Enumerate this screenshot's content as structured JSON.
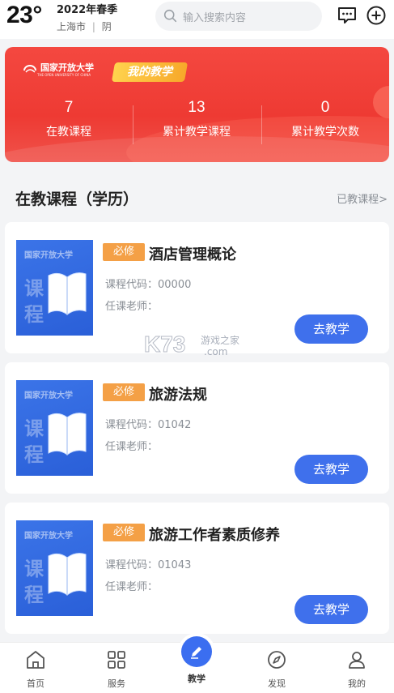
{
  "header": {
    "temperature": "23°",
    "term": "2022年春季",
    "location": "上海市",
    "weather": "阴",
    "search_placeholder": "输入搜索内容"
  },
  "banner": {
    "university": "国家开放大学",
    "university_en": "THE OPEN UNIVERSITY OF CHINA",
    "tag": "我的教学",
    "stats": [
      {
        "value": "7",
        "label": "在教课程"
      },
      {
        "value": "13",
        "label": "累计教学课程"
      },
      {
        "value": "0",
        "label": "累计教学次数"
      }
    ]
  },
  "section": {
    "title": "在教课程（学历）",
    "more": "已教课程>"
  },
  "courses": [
    {
      "badge": "必修",
      "name": "酒店管理概论",
      "code_label": "课程代码：00000",
      "teacher_label": "任课老师：",
      "button": "去教学"
    },
    {
      "badge": "必修",
      "name": "旅游法规",
      "code_label": "课程代码：01042",
      "teacher_label": "任课老师：",
      "button": "去教学"
    },
    {
      "badge": "必修",
      "name": "旅游工作者素质修养",
      "code_label": "课程代码：01043",
      "teacher_label": "任课老师：",
      "button": "去教学"
    }
  ],
  "cover": {
    "top": "国家开放大学",
    "char1": "课",
    "char2": "程"
  },
  "watermark": {
    "brand": "K73",
    "line1": "游戏之家",
    "line2": ".com"
  },
  "nav": [
    {
      "label": "首页",
      "icon": "home-icon"
    },
    {
      "label": "服务",
      "icon": "grid-icon"
    },
    {
      "label": "教学",
      "icon": "pen-icon"
    },
    {
      "label": "发现",
      "icon": "compass-icon"
    },
    {
      "label": "我的",
      "icon": "user-icon"
    }
  ],
  "colors": {
    "accent": "#3f70ec",
    "banner_red": "#f04840",
    "badge_orange": "#f4a046"
  }
}
